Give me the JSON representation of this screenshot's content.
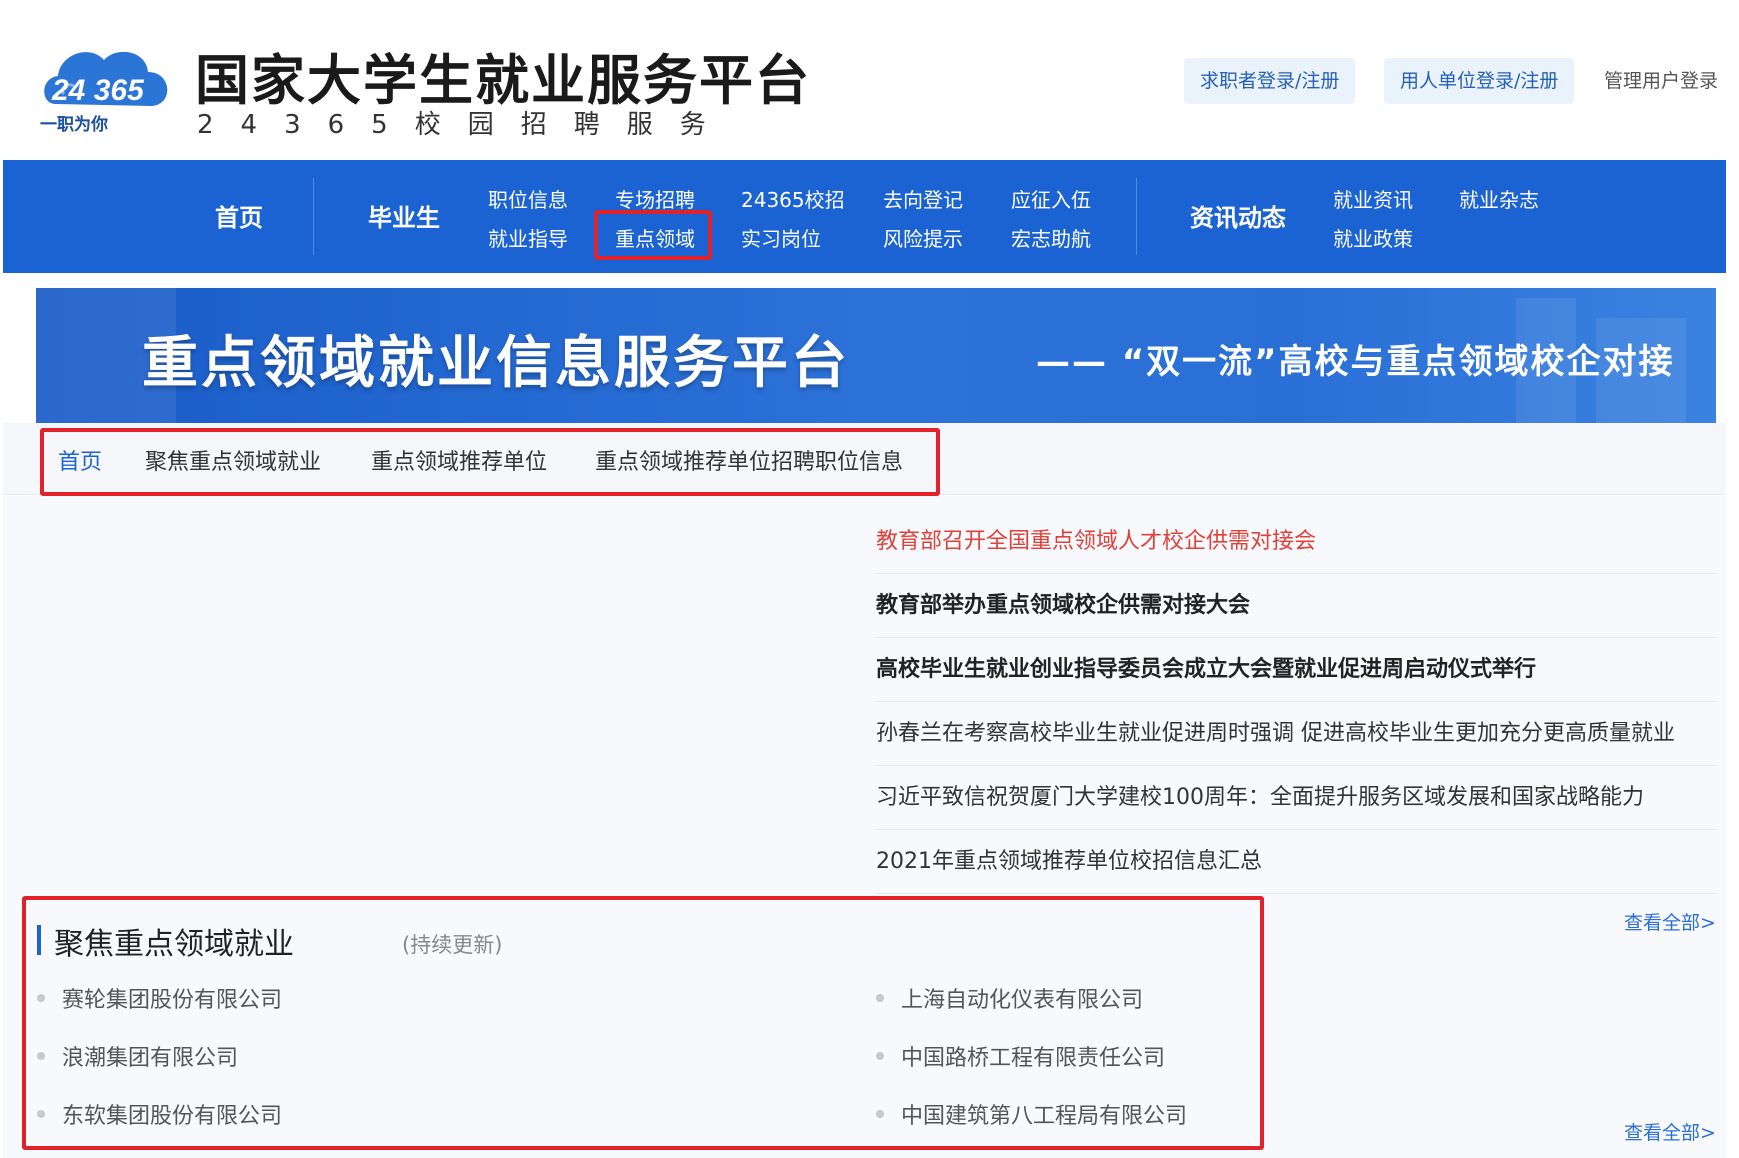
{
  "brand": {
    "logo_number": "24 365",
    "logo_slogan": "一职为你",
    "title": "国家大学生就业服务平台",
    "subtitle": "24365校园招聘服务"
  },
  "auth": {
    "job_seeker": "求职者登录/注册",
    "employer": "用人单位登录/注册",
    "admin": "管理用户登录"
  },
  "nav": {
    "home": "首页",
    "graduates": "毕业生",
    "sub": {
      "job_info": "职位信息",
      "guidance": "就业指导",
      "special": "专场招聘",
      "key_fields": "重点领域",
      "campus": "24365校招",
      "intern": "实习岗位",
      "destination": "去向登记",
      "risk": "风险提示",
      "enlist": "应征入伍",
      "western": "宏志助航"
    },
    "news": "资讯动态",
    "news_sub": {
      "info": "就业资讯",
      "magazine": "就业杂志",
      "policy": "就业政策"
    }
  },
  "banner": {
    "title": "重点领域就业信息服务平台",
    "subtitle": "—— “双一流”高校与重点领域校企对接"
  },
  "subnav": [
    "首页",
    "聚焦重点领域就业",
    "重点领域推荐单位",
    "重点领域推荐单位招聘职位信息"
  ],
  "news": [
    {
      "text": "教育部召开全国重点领域人才校企供需对接会",
      "style": "red"
    },
    {
      "text": "教育部举办重点领域校企供需对接大会",
      "style": "bold"
    },
    {
      "text": "高校毕业生就业创业指导委员会成立大会暨就业促进周启动仪式举行",
      "style": "bold"
    },
    {
      "text": "孙春兰在考察高校毕业生就业促进周时强调 促进高校毕业生更加充分更高质量就业",
      "style": "normal"
    },
    {
      "text": "习近平致信祝贺厦门大学建校100周年：全面提升服务区域发展和国家战略能力",
      "style": "normal"
    },
    {
      "text": "2021年重点领域推荐单位校招信息汇总",
      "style": "normal"
    }
  ],
  "view_all": "查看全部>",
  "focus": {
    "title": "聚焦重点领域就业",
    "note": "(持续更新)",
    "companies_left": [
      "赛轮集团股份有限公司",
      "浪潮集团有限公司",
      "东软集团股份有限公司"
    ],
    "companies_right": [
      "上海自动化仪表有限公司",
      "中国路桥工程有限责任公司",
      "中国建筑第八工程局有限公司"
    ]
  },
  "colors": {
    "primary": "#1b63d3",
    "highlight": "#e0232b",
    "news_red": "#e0423a"
  }
}
